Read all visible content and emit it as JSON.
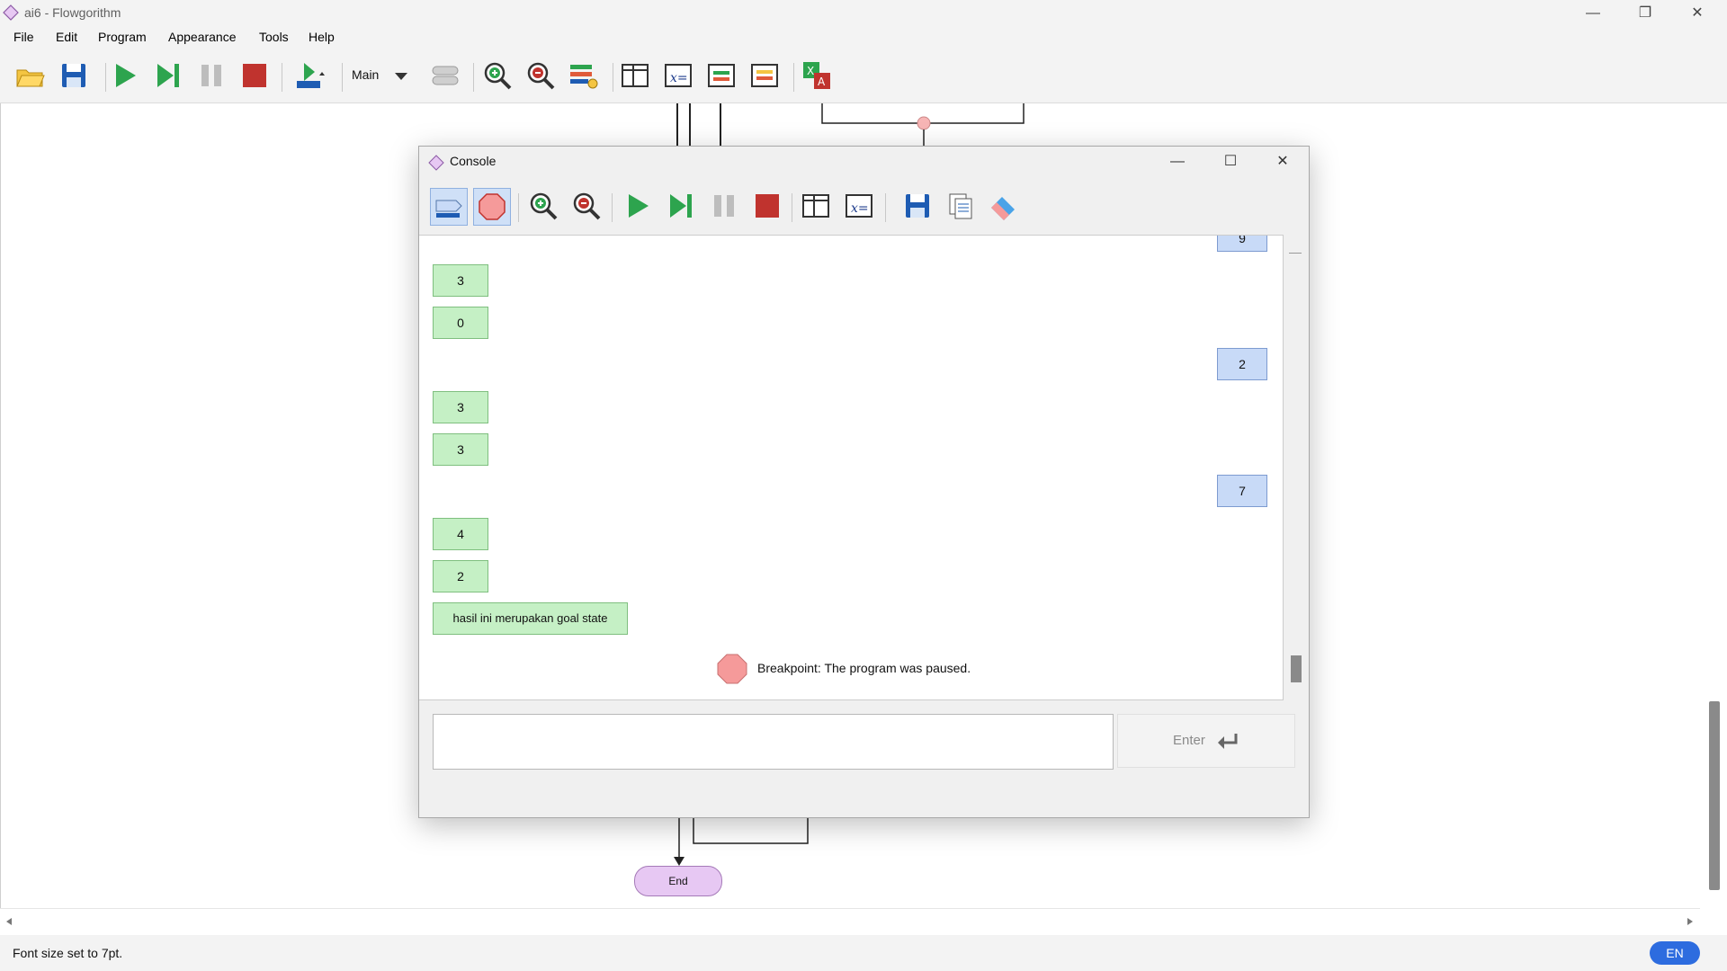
{
  "window": {
    "title": "ai6 - Flowgorithm"
  },
  "menu": [
    "File",
    "Edit",
    "Program",
    "Appearance",
    "Tools",
    "Help"
  ],
  "toolbar": {
    "function_label": "Main"
  },
  "status": {
    "message": "Font size set to 7pt.",
    "language": "EN"
  },
  "flowchart": {
    "end_label": "End"
  },
  "console": {
    "title": "Console",
    "output": {
      "top_partial_input": "9",
      "out1": "3",
      "out2": "0",
      "in1": "2",
      "out3": "3",
      "out4": "3",
      "in2": "7",
      "out5": "4",
      "out6": "2",
      "message": "hasil ini merupakan goal state",
      "breakpoint": "Breakpoint: The program was paused."
    },
    "input": {
      "value": "",
      "enter_label": "Enter"
    }
  },
  "colors": {
    "output_bubble": "#c5f0c5",
    "input_bubble": "#c8daf7",
    "breakpoint": "#f59a9a",
    "accent": "#2d6cdf"
  }
}
